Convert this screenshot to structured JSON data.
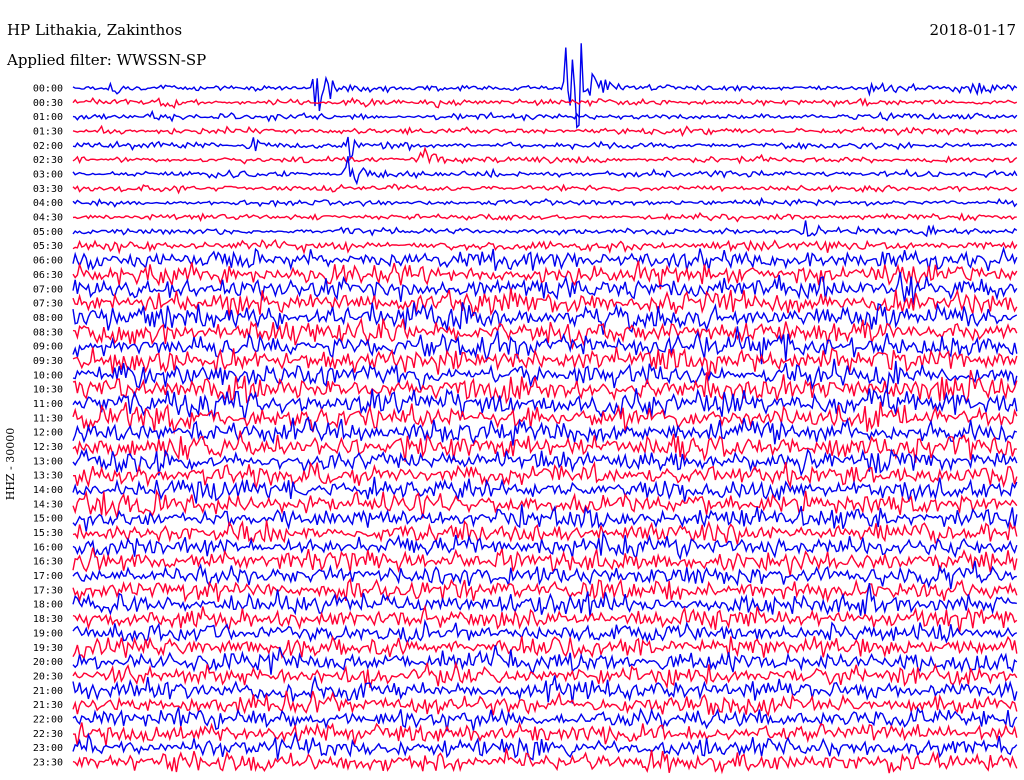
{
  "header": {
    "station": "HP Lithakia, Zakinthos",
    "filter": "Applied filter: WWSSN-SP",
    "date": "2018-01-17"
  },
  "chart_data": {
    "type": "line",
    "title": "HP Lithakia, Zakinthos",
    "subtitle": "Applied filter: WWSSN-SP",
    "ylabel": "HHZ - 30000",
    "colors": [
      "#0000ee",
      "#ff0033"
    ],
    "categories": [
      "00:00",
      "00:30",
      "01:00",
      "01:30",
      "02:00",
      "02:30",
      "03:00",
      "03:30",
      "04:00",
      "04:30",
      "05:00",
      "05:30",
      "06:00",
      "06:30",
      "07:00",
      "07:30",
      "08:00",
      "08:30",
      "09:00",
      "09:30",
      "10:00",
      "10:30",
      "11:00",
      "11:30",
      "12:00",
      "12:30",
      "13:00",
      "13:30",
      "14:00",
      "14:30",
      "15:00",
      "15:30",
      "16:00",
      "16:30",
      "17:00",
      "17:30",
      "18:00",
      "18:30",
      "19:00",
      "19:30",
      "20:00",
      "20:30",
      "21:00",
      "21:30",
      "22:00",
      "22:30",
      "23:00",
      "23:30"
    ],
    "x_range_minutes": [
      0,
      30
    ],
    "noise_level": [
      1,
      1,
      1,
      1,
      1,
      1,
      1,
      1,
      1,
      1,
      1,
      1.6,
      3,
      3.4,
      3.6,
      3.8,
      4,
      4,
      4,
      4,
      4,
      4,
      4,
      4,
      3.8,
      3.8,
      3.6,
      3.6,
      3.4,
      3.4,
      3.4,
      3.4,
      3.4,
      3.4,
      3.2,
      3.2,
      3.2,
      3.2,
      3.2,
      3.2,
      3.2,
      3.2,
      3.2,
      3.2,
      3.2,
      3.2,
      3.2,
      3.2
    ],
    "events": [
      {
        "row": 0,
        "minute": 1.1,
        "amplitude": 6
      },
      {
        "row": 0,
        "minute": 7.6,
        "amplitude": 22
      },
      {
        "row": 0,
        "minute": 15.6,
        "amplitude": 70
      },
      {
        "row": 0,
        "minute": 25.2,
        "amplitude": 5
      },
      {
        "row": 0,
        "minute": 28.5,
        "amplitude": 12
      },
      {
        "row": 1,
        "minute": 2.6,
        "amplitude": 3
      },
      {
        "row": 1,
        "minute": 11.5,
        "amplitude": 3
      },
      {
        "row": 1,
        "minute": 18.5,
        "amplitude": 2
      },
      {
        "row": 1,
        "minute": 8.9,
        "amplitude": 4
      },
      {
        "row": 2,
        "minute": 2.4,
        "amplitude": 6
      },
      {
        "row": 2,
        "minute": 25.5,
        "amplitude": 5
      },
      {
        "row": 3,
        "minute": 0.8,
        "amplitude": 5
      },
      {
        "row": 4,
        "minute": 5.5,
        "amplitude": 6
      },
      {
        "row": 4,
        "minute": 8.7,
        "amplitude": 7
      },
      {
        "row": 5,
        "minute": 11.0,
        "amplitude": 9
      },
      {
        "row": 6,
        "minute": 8.6,
        "amplitude": 14
      },
      {
        "row": 10,
        "minute": 23.1,
        "amplitude": 10
      },
      {
        "row": 10,
        "minute": 27.0,
        "amplitude": 7
      },
      {
        "row": 14,
        "minute": 26.2,
        "amplitude": 12
      },
      {
        "row": 21,
        "minute": 27.2,
        "amplitude": 9
      },
      {
        "row": 26,
        "minute": 26.5,
        "amplitude": 8
      },
      {
        "row": 36,
        "minute": 25.0,
        "amplitude": 9
      }
    ]
  }
}
